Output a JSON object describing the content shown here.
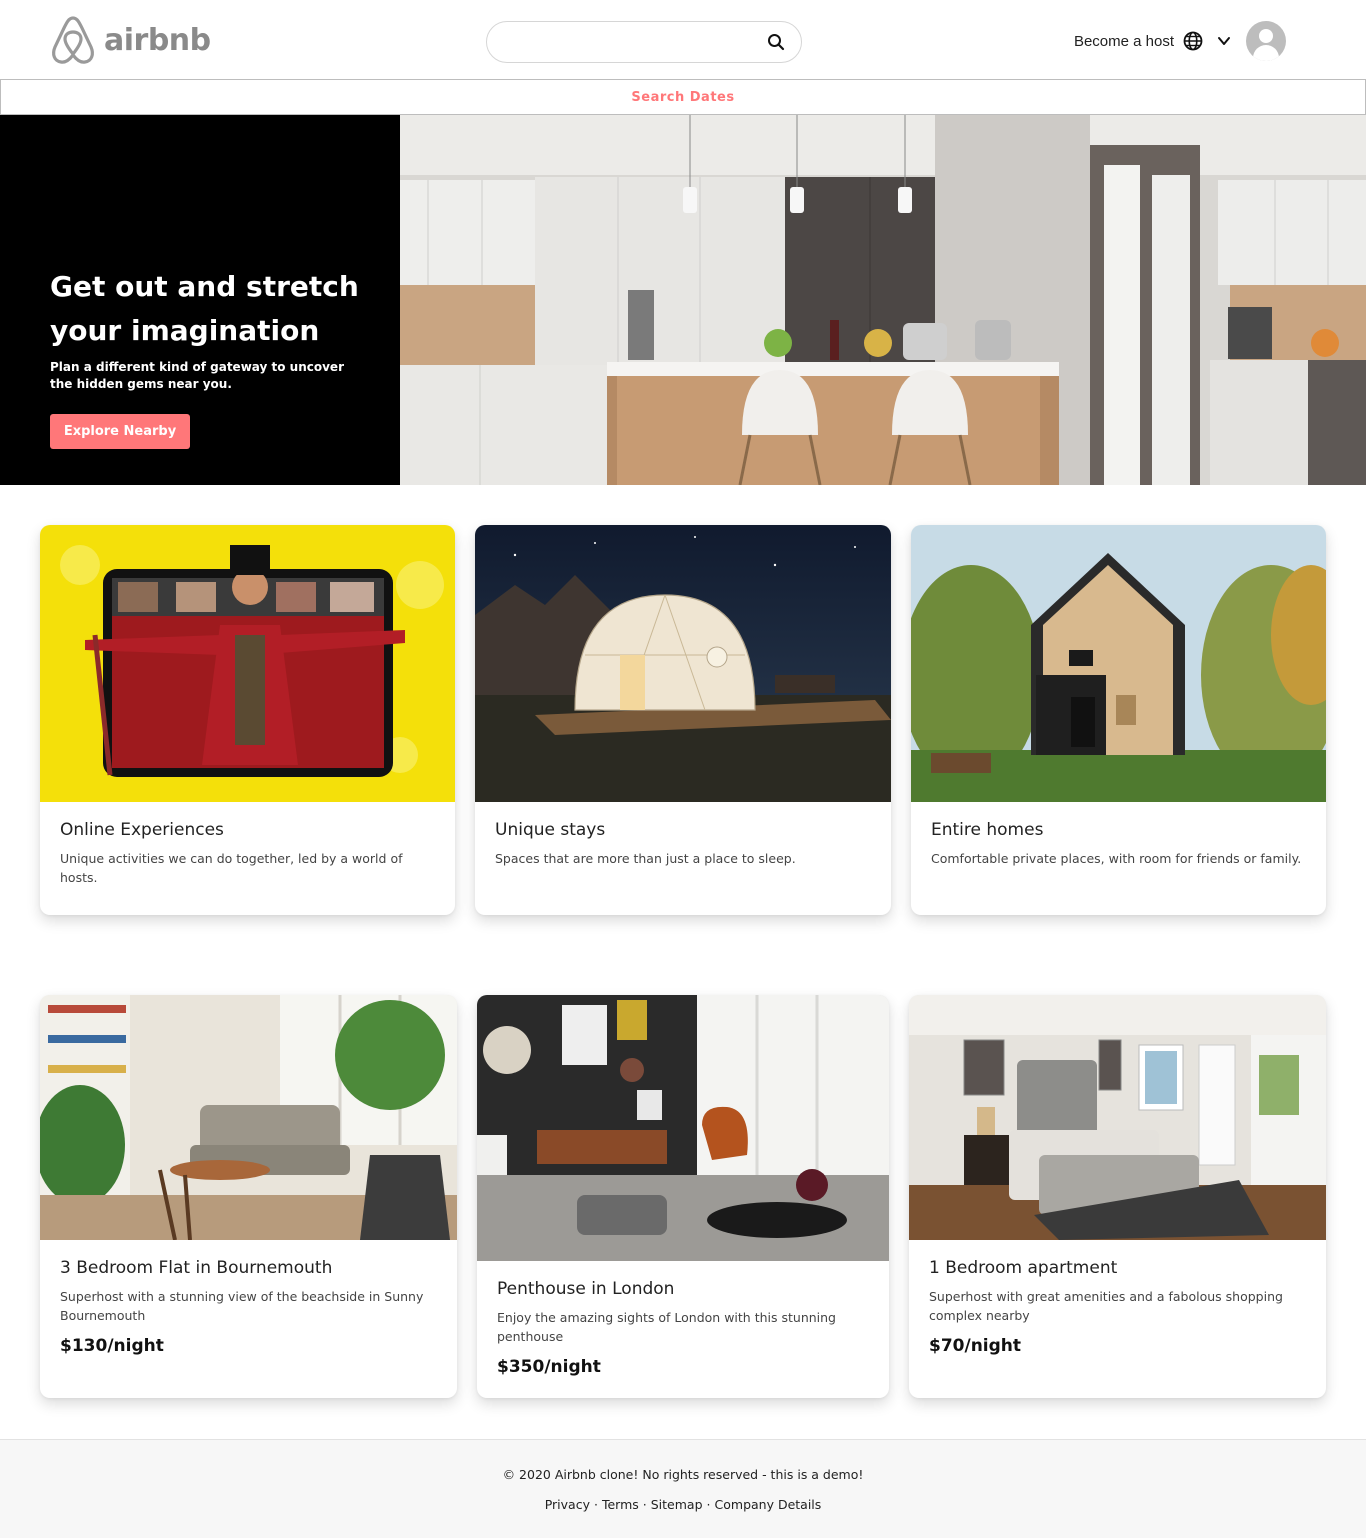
{
  "header": {
    "logo_text": "airbnb",
    "search_placeholder": "",
    "become_host": "Become a host",
    "brand_color": "#ff7779"
  },
  "dates_bar": {
    "label": "Search Dates"
  },
  "hero": {
    "title": "Get out and stretch your imagination",
    "subtitle": "Plan a different kind of gateway to uncover the hidden gems near you.",
    "button": "Explore Nearby"
  },
  "categories": [
    {
      "title": "Online Experiences",
      "description": "Unique activities we can do together, led by a world of hosts."
    },
    {
      "title": "Unique stays",
      "description": "Spaces that are more than just a place to sleep."
    },
    {
      "title": "Entire homes",
      "description": "Comfortable private places, with room for friends or family."
    }
  ],
  "listings": [
    {
      "title": "3 Bedroom Flat in Bournemouth",
      "description": "Superhost with a stunning view of the beachside in Sunny Bournemouth",
      "price": "$130/night"
    },
    {
      "title": "Penthouse in London",
      "description": "Enjoy the amazing sights of London with this stunning penthouse",
      "price": "$350/night"
    },
    {
      "title": "1 Bedroom apartment",
      "description": "Superhost with great amenities and a fabolous shopping complex nearby",
      "price": "$70/night"
    }
  ],
  "footer": {
    "copyright": "© 2020 Airbnb clone! No rights reserved - this is a demo!",
    "links": [
      "Privacy",
      "Terms",
      "Sitemap",
      "Company Details"
    ]
  }
}
